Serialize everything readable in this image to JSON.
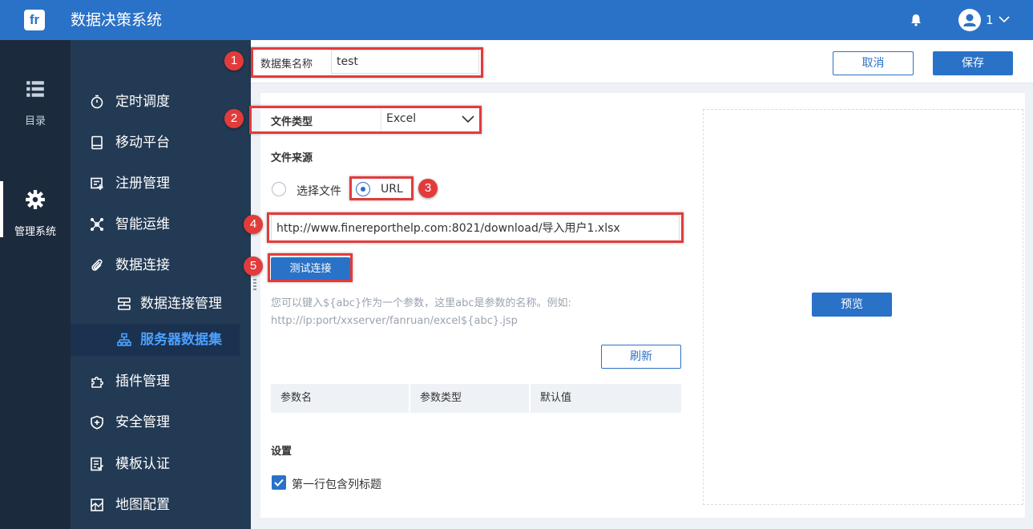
{
  "header": {
    "logo_text": "fr",
    "title": "数据决策系统",
    "user_name": "1"
  },
  "rail": {
    "items": [
      {
        "label": "目录",
        "icon": "list-icon"
      },
      {
        "label": "管理系统",
        "icon": "gear-icon"
      }
    ]
  },
  "sidebar": {
    "items": [
      {
        "label": "定时调度",
        "icon": "timer-icon"
      },
      {
        "label": "移动平台",
        "icon": "tablet-icon"
      },
      {
        "label": "注册管理",
        "icon": "register-icon"
      },
      {
        "label": "智能运维",
        "icon": "nodes-icon"
      },
      {
        "label": "数据连接",
        "icon": "paperclip-icon"
      },
      {
        "label": "数据连接管理",
        "icon": "database-icon"
      },
      {
        "label": "服务器数据集",
        "icon": "dataset-icon"
      },
      {
        "label": "插件管理",
        "icon": "puzzle-icon"
      },
      {
        "label": "安全管理",
        "icon": "shield-icon"
      },
      {
        "label": "模板认证",
        "icon": "template-icon"
      },
      {
        "label": "地图配置",
        "icon": "map-icon"
      }
    ]
  },
  "form": {
    "dataset_name_label": "数据集名称",
    "dataset_name_value": "test",
    "cancel_label": "取消",
    "save_label": "保存",
    "file_type_label": "文件类型",
    "file_type_value": "Excel",
    "file_source_label": "文件来源",
    "source_option_file": "选择文件",
    "source_option_url": "URL",
    "url_value": "http://www.finereporthelp.com:8021/download/导入用户1.xlsx",
    "test_connection_label": "测试连接",
    "hint_line1": "您可以键入${abc}作为一个参数，这里abc是参数的名称。例如:",
    "hint_line2": "http://ip:port/xxserver/fanruan/excel${abc}.jsp",
    "refresh_label": "刷新",
    "table_headers": [
      "参数名",
      "参数类型",
      "默认值"
    ],
    "settings_label": "设置",
    "first_row_header_label": "第一行包含列标题",
    "preview_label": "预览"
  },
  "annotations": {
    "badges": [
      "1",
      "2",
      "3",
      "4",
      "5"
    ]
  },
  "colors": {
    "topbar": "#2a72c7",
    "rail": "#1b2a3d",
    "sidebar": "#233a54",
    "accent": "#2a72c7",
    "annotation": "#e23b3b"
  }
}
